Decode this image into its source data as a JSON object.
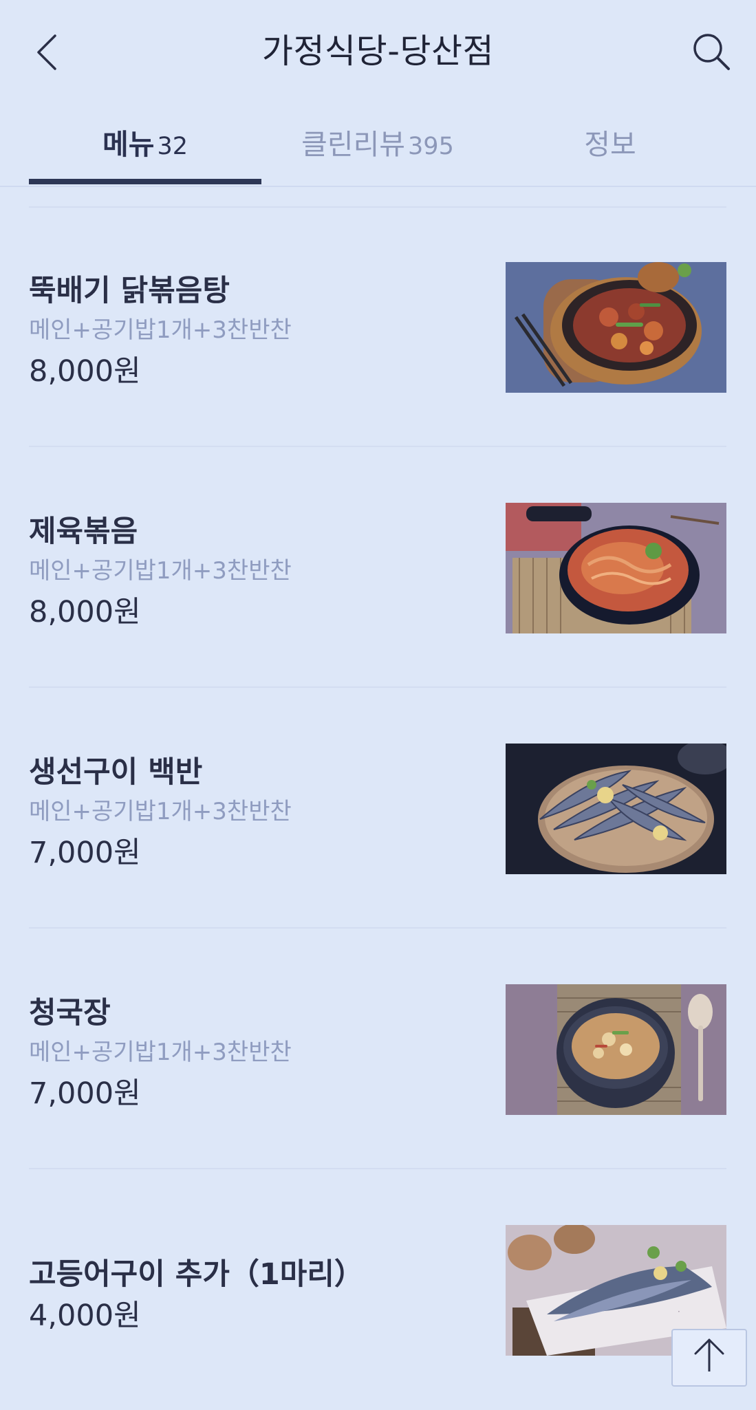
{
  "header": {
    "title": "가정식당-당산점",
    "back_icon": "chevron-left-icon",
    "search_icon": "search-icon"
  },
  "tabs": [
    {
      "label": "메뉴",
      "count": "32",
      "active": true
    },
    {
      "label": "클린리뷰",
      "count": "395",
      "active": false
    },
    {
      "label": "정보",
      "count": "",
      "active": false
    }
  ],
  "menu": {
    "items": [
      {
        "name": "뚝배기 닭볶음탕",
        "desc": "메인+공기밥1개+3찬반찬",
        "price": "8,000원",
        "image": "braised-chicken-photo"
      },
      {
        "name": "제육볶음",
        "desc": "메인+공기밥1개+3찬반찬",
        "price": "8,000원",
        "image": "spicy-pork-photo"
      },
      {
        "name": "생선구이 백반",
        "desc": "메인+공기밥1개+3찬반찬",
        "price": "7,000원",
        "image": "grilled-fish-photo"
      },
      {
        "name": "청국장",
        "desc": "메인+공기밥1개+3찬반찬",
        "price": "7,000원",
        "image": "soybean-stew-photo"
      },
      {
        "name": "고등어구이 추가（1마리）",
        "desc": "",
        "price": "4,000원",
        "image": "grilled-mackerel-photo"
      }
    ]
  },
  "scroll_top": {
    "icon": "arrow-up-icon"
  },
  "colors": {
    "background": "#dde7f8",
    "tab_indicator": "#2d3756",
    "muted_text": "#8f9cc0"
  }
}
